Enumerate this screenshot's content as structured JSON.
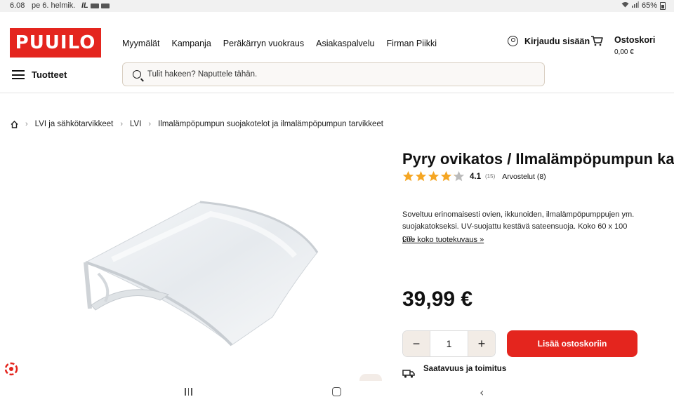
{
  "status_bar": {
    "time": "6.08",
    "date": "pe 6. helmik.",
    "notification_text": "IL",
    "battery": "65%"
  },
  "header": {
    "logo": "PUUILO",
    "nav": [
      "Myymälät",
      "Kampanja",
      "Peräkärryn vuokraus",
      "Asiakaspalvelu",
      "Firman Piikki"
    ],
    "login_label": "Kirjaudu sisään",
    "cart_title": "Ostoskori",
    "cart_total": "0,00 €",
    "menu_label": "Tuotteet",
    "search_placeholder": "Tulit hakeen? Naputtele tähän."
  },
  "breadcrumb": [
    "LVI ja sähkötarvikkeet",
    "LVI",
    "Ilmalämpöpumpun suojakotelot ja ilmalämpöpumpun tarvikkeet"
  ],
  "product": {
    "title": "Pyry ovikatos / Ilmalämpöpumpun katos",
    "rating": 4.1,
    "rating_text": "4.1",
    "rating_count": "(15)",
    "reviews_label": "Arvostelut (8)",
    "description": "Soveltuu erinomaisesti ovien, ikkunoiden, ilmalämpöpumppujen ym. suojakatokseksi. UV-suojattu kestävä sateensuoja. Koko 60 x 100 cm.",
    "more_link": "Lue koko tuotekuvaus »",
    "price": "39,99 €",
    "quantity": "1",
    "add_to_cart": "Lisää ostoskoriin",
    "availability_title": "Saatavuus ja toimitus"
  },
  "colors": {
    "brand_red": "#e4251e",
    "star": "#f5a623",
    "qty_bg": "#f2ece6"
  },
  "icons": [
    "user-icon",
    "cart-icon",
    "hamburger-icon",
    "search-icon",
    "home-icon",
    "truck-icon",
    "star-icon"
  ]
}
